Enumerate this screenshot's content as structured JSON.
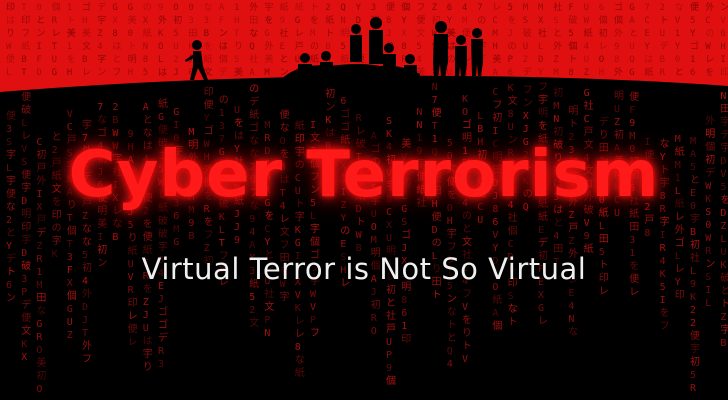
{
  "banner": {
    "title": "Cyber Terrorism",
    "subtitle": "Virtual Terror is Not So Virtual"
  },
  "colors": {
    "background": "#000000",
    "top_band": "#e01010",
    "title": "#ff1a1a",
    "subtitle": "#f0f0f0",
    "glyph": "#c81414"
  },
  "decor": {
    "background_glyphs": "を初美と宇印便の文紙なフト社明便ゴ田ン紙は破レ戸り外字個デ0123456789ABCDEFGHIJKLMNOPQRSTUVWXYZ",
    "silhouette": "people-silhouettes"
  }
}
